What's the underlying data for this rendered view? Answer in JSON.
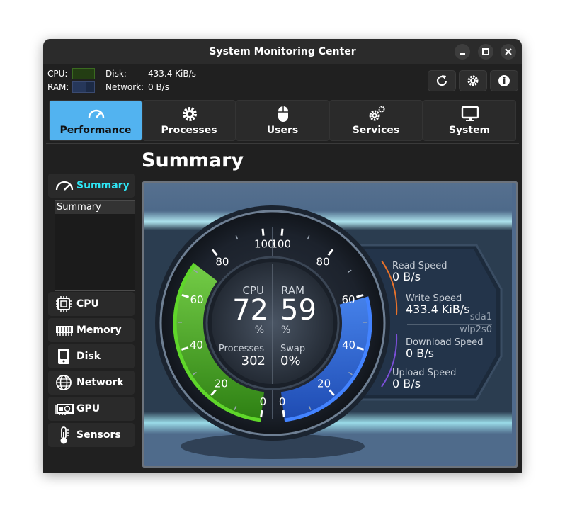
{
  "window": {
    "title": "System Monitoring Center"
  },
  "header": {
    "cpu_label": "CPU:",
    "ram_label": "RAM:",
    "disk_label": "Disk:",
    "disk_value": "433.4 KiB/s",
    "network_label": "Network:",
    "network_value": "0 B/s"
  },
  "tabs": [
    {
      "label": "Performance",
      "icon": "gauge-icon",
      "active": true
    },
    {
      "label": "Processes",
      "icon": "gear-icon",
      "active": false
    },
    {
      "label": "Users",
      "icon": "mouse-icon",
      "active": false
    },
    {
      "label": "Services",
      "icon": "gears-icon",
      "active": false
    },
    {
      "label": "System",
      "icon": "monitor-icon",
      "active": false
    }
  ],
  "sidebar": {
    "summary_label": "Summary",
    "summary_list": [
      "Summary"
    ],
    "items": [
      {
        "label": "CPU",
        "icon": "cpu-icon"
      },
      {
        "label": "Memory",
        "icon": "memory-icon"
      },
      {
        "label": "Disk",
        "icon": "disk-icon"
      },
      {
        "label": "Network",
        "icon": "globe-icon"
      },
      {
        "label": "GPU",
        "icon": "gpu-icon"
      },
      {
        "label": "Sensors",
        "icon": "thermometer-icon"
      }
    ]
  },
  "main": {
    "heading": "Summary"
  },
  "gauge": {
    "cpu": {
      "label": "CPU",
      "value": "72",
      "unit": "%",
      "percent": 72
    },
    "ram": {
      "label": "RAM",
      "value": "59",
      "unit": "%",
      "percent": 59
    },
    "processes": {
      "label": "Processes",
      "value": "302"
    },
    "swap": {
      "label": "Swap",
      "value": "0%"
    },
    "scale_ticks": [
      "0",
      "20",
      "40",
      "60",
      "80",
      "100"
    ],
    "disk": {
      "read_label": "Read Speed",
      "read_value": "0 B/s",
      "write_label": "Write Speed",
      "write_value": "433.4 KiB/s",
      "device": "sda1"
    },
    "network": {
      "device": "wlp2s0",
      "download_label": "Download Speed",
      "download_value": "0 B/s",
      "upload_label": "Upload Speed",
      "upload_value": "0 B/s"
    },
    "colors": {
      "cpu": "#4fc21a",
      "ram": "#3f7df0",
      "read": "#e8722a",
      "upload": "#7b4fd8"
    }
  }
}
